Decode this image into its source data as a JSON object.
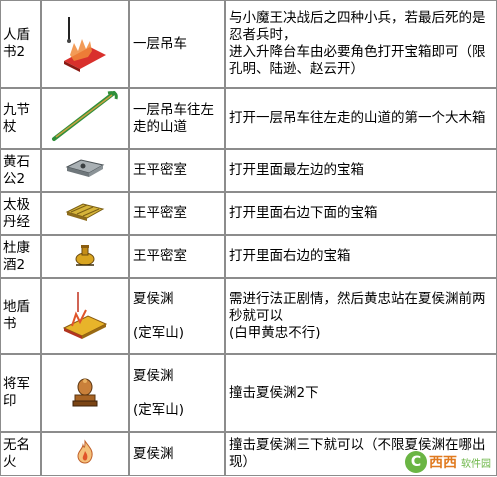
{
  "rows": [
    {
      "name": "人盾书2",
      "icon": "red-book-shield-icon",
      "location": "一层吊车",
      "desc": "与小魔王决战后之四种小兵，若最后死的是忍者兵时，\n进入升降台车由必要角色打开宝箱即可（限孔明、陆逊、赵云开）"
    },
    {
      "name": "九节杖",
      "icon": "green-staff-icon",
      "location": "一层吊车往左走的山道",
      "desc": "打开一层吊车往左走的山道的第一个大木箱"
    },
    {
      "name": "黄石公2",
      "icon": "stone-tablet-icon",
      "location": "王平密室",
      "desc": "打开里面最左边的宝箱"
    },
    {
      "name": "太极丹经",
      "icon": "gold-scroll-icon",
      "location": "王平密室",
      "desc": "打开里面右边下面的宝箱"
    },
    {
      "name": "杜康酒2",
      "icon": "wine-jug-icon",
      "location": "王平密室",
      "desc": "打开里面右边的宝箱"
    },
    {
      "name": "地盾书",
      "icon": "yellow-book-shield-icon",
      "location": "夏侯渊\n\n(定军山)",
      "desc": "需进行法正剧情，然后黄忠站在夏侯渊前两秒就可以\n(白甲黄忠不行)"
    },
    {
      "name": "将军印",
      "icon": "general-seal-icon",
      "location": "夏侯渊\n\n(定军山)",
      "desc": "撞击夏侯渊2下"
    },
    {
      "name": "无名火",
      "icon": "flame-icon",
      "location": "夏侯渊",
      "desc": "撞击夏侯渊三下就可以（不限夏侯渊在哪出现）"
    }
  ],
  "watermark": {
    "logo_letter": "C",
    "brand": "西西",
    "sub": "软件园"
  }
}
